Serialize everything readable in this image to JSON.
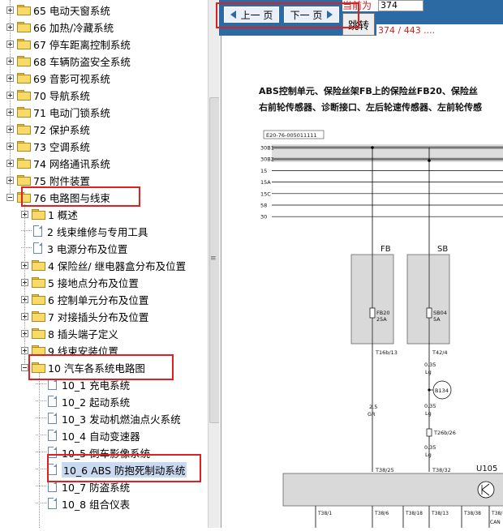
{
  "tree": {
    "items": [
      {
        "label": "65 电动天窗系统"
      },
      {
        "label": "66 加热/冷藏系统"
      },
      {
        "label": "67 停车距离控制系统"
      },
      {
        "label": "68 车辆防盗安全系统"
      },
      {
        "label": "69 音影可视系统"
      },
      {
        "label": "70 导航系统"
      },
      {
        "label": "71 电动门锁系统"
      },
      {
        "label": "72 保护系统"
      },
      {
        "label": "73 空调系统"
      },
      {
        "label": "74 网络通讯系统"
      },
      {
        "label": "75 附件装置"
      },
      {
        "label": "76 电路图与线束"
      },
      {
        "label": "1 概述"
      },
      {
        "label": "2 线束维修与专用工具"
      },
      {
        "label": "3 电源分布及位置"
      },
      {
        "label": "4 保险丝/ 继电器盒分布及位置"
      },
      {
        "label": "5 接地点分布及位置"
      },
      {
        "label": "6 控制单元分布及位置"
      },
      {
        "label": "7 对接插头分布及位置"
      },
      {
        "label": "8 插头端子定义"
      },
      {
        "label": "9 线束安装位置"
      },
      {
        "label": "10 汽车各系统电路图"
      },
      {
        "label": "10_1 充电系统"
      },
      {
        "label": "10_2 起动系统"
      },
      {
        "label": "10_3 发动机燃油点火系统"
      },
      {
        "label": "10_4 自动变速器"
      },
      {
        "label": "10_5 倒车影像系统"
      },
      {
        "label": "10_6 ABS 防抱死制动系统"
      },
      {
        "label": "10_7 防盗系统"
      },
      {
        "label": "10_8 组合仪表"
      }
    ]
  },
  "splitter": {
    "grip": "≡"
  },
  "viewer": {
    "prev_label": "上一 页",
    "next_label": "下一 页",
    "current_label": "当前为",
    "current_value": "374",
    "jump_label": "跳转",
    "page_counter": "374 / 443 ....",
    "diagram": {
      "heading_line1": "ABS控制单元、保险丝架FB上的保险丝FB20、保险丝",
      "heading_line2": "右前轮传感器、诊断接口、左后轮速传感器、左前轮传感",
      "code": "E20-76-005011111",
      "rails": [
        "30B1",
        "30B2",
        "15",
        "15A",
        "15C",
        "58",
        "30"
      ],
      "fb_label": "FB",
      "sb_label": "SB",
      "fb20_label": "FB20",
      "fb20_amp": "25A",
      "sb04_label": "SB04",
      "sb04_amp": "5A",
      "t16": "T16b/13",
      "t42": "T42/4",
      "b134": "B134",
      "w1": "0.35",
      "w1c": "Lg",
      "w2": "0.35",
      "w2c": "Lg",
      "w3": "0.35",
      "w3c": "Lg",
      "t26": "T26b/26",
      "gauge_fb": "2.5",
      "color_fb": "GR",
      "t38_25": "T38/25",
      "t38_32": "T38/32",
      "u105": "U105",
      "bottom_pins": [
        "T38/1",
        "T38/6",
        "T38/18",
        "T38/13",
        "T38/38",
        "T38/1"
      ],
      "can": "CAN"
    }
  }
}
